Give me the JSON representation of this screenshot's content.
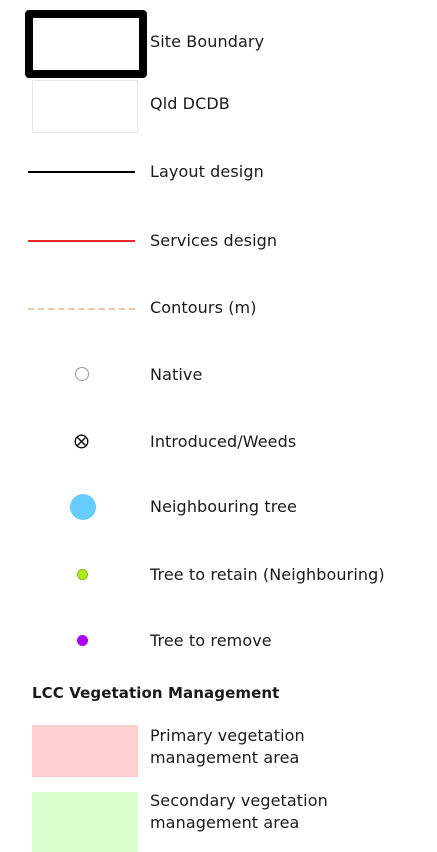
{
  "legend": {
    "items": [
      {
        "label": "Site Boundary",
        "symbol": "thick-black-outline-box"
      },
      {
        "label": "Qld DCDB",
        "symbol": "thin-grey-outline-box"
      },
      {
        "label": "Layout design",
        "symbol": "solid-line",
        "color": "#000000"
      },
      {
        "label": "Services design",
        "symbol": "solid-line",
        "color": "#e52b2b"
      },
      {
        "label": "Contours (m)",
        "symbol": "dashed-line",
        "color": "#e8c8a8"
      },
      {
        "label": "Native",
        "symbol": "hollow-circle-icon",
        "color": "#9a9a9a"
      },
      {
        "label": "Introduced/Weeds",
        "symbol": "circled-x-icon",
        "color": "#000000"
      },
      {
        "label": "Neighbouring tree",
        "symbol": "large-filled-circle",
        "color": "#66ccff"
      },
      {
        "label": "Tree to retain (Neighbouring)",
        "symbol": "small-filled-circle",
        "color": "#aaee22"
      },
      {
        "label": "Tree to remove",
        "symbol": "small-filled-circle",
        "color": "#aa00ee"
      }
    ],
    "vegetation": {
      "title": "LCC Vegetation Management",
      "items": [
        {
          "label_line1": "Primary vegetation",
          "label_line2": "management area",
          "color": "#ffcfcf"
        },
        {
          "label_line1": "Secondary vegetation",
          "label_line2": "management area",
          "color": "#d9ffce"
        }
      ]
    }
  }
}
